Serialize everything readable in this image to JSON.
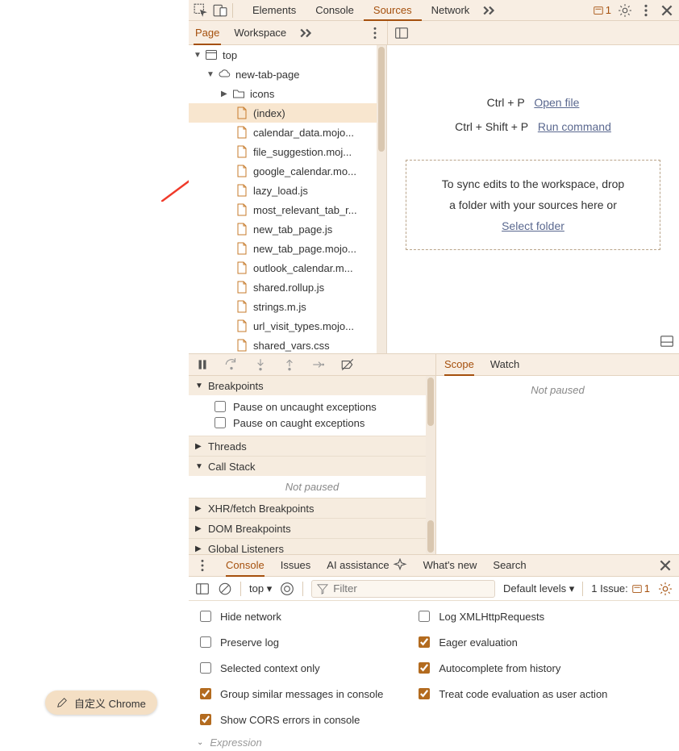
{
  "toolbar": {
    "tabs": [
      "Elements",
      "Console",
      "Sources",
      "Network"
    ],
    "active": "Sources",
    "issueCount": "1"
  },
  "subtabs": {
    "items": [
      "Page",
      "Workspace"
    ],
    "active": "Page"
  },
  "tree": {
    "root": "top",
    "domain": "new-tab-page",
    "folder": "icons",
    "files": [
      "(index)",
      "calendar_data.mojo...",
      "file_suggestion.moj...",
      "google_calendar.mo...",
      "lazy_load.js",
      "most_relevant_tab_r...",
      "new_tab_page.js",
      "new_tab_page.mojo...",
      "outlook_calendar.m...",
      "shared.rollup.js",
      "strings.m.js",
      "url_visit_types.mojo...",
      "shared_vars.css"
    ],
    "selected": "(index)"
  },
  "editorHints": {
    "k1": "Ctrl + P",
    "a1": "Open file",
    "k2": "Ctrl + Shift + P",
    "a2": "Run command",
    "drop1": "To sync edits to the workspace, drop",
    "drop2": "a folder with your sources here or",
    "dropLink": "Select folder"
  },
  "scopeTabs": {
    "items": [
      "Scope",
      "Watch"
    ],
    "active": "Scope",
    "notPaused": "Not paused"
  },
  "dbgSections": {
    "breakpoints": "Breakpoints",
    "uncaught": "Pause on uncaught exceptions",
    "caught": "Pause on caught exceptions",
    "threads": "Threads",
    "callstack": "Call Stack",
    "notPaused": "Not paused",
    "xhr": "XHR/fetch Breakpoints",
    "dom": "DOM Breakpoints",
    "global": "Global Listeners"
  },
  "drawerTabs": {
    "items": [
      "Console",
      "Issues",
      "AI assistance",
      "What's new",
      "Search"
    ],
    "active": "Console"
  },
  "consoleFilter": {
    "context": "top",
    "filterPlaceholder": "Filter",
    "levels": "Default levels",
    "issuesLabel": "1 Issue:",
    "issuesCount": "1"
  },
  "consoleSettings": {
    "left": [
      {
        "label": "Hide network",
        "checked": false
      },
      {
        "label": "Preserve log",
        "checked": false
      },
      {
        "label": "Selected context only",
        "checked": false
      },
      {
        "label": "Group similar messages in console",
        "checked": true
      },
      {
        "label": "Show CORS errors in console",
        "checked": true
      }
    ],
    "right": [
      {
        "label": "Log XMLHttpRequests",
        "checked": false
      },
      {
        "label": "Eager evaluation",
        "checked": true
      },
      {
        "label": "Autocomplete from history",
        "checked": true
      },
      {
        "label": "Treat code evaluation as user action",
        "checked": true
      }
    ],
    "expression": "Expression"
  },
  "pill": {
    "label": "自定义 Chrome"
  }
}
